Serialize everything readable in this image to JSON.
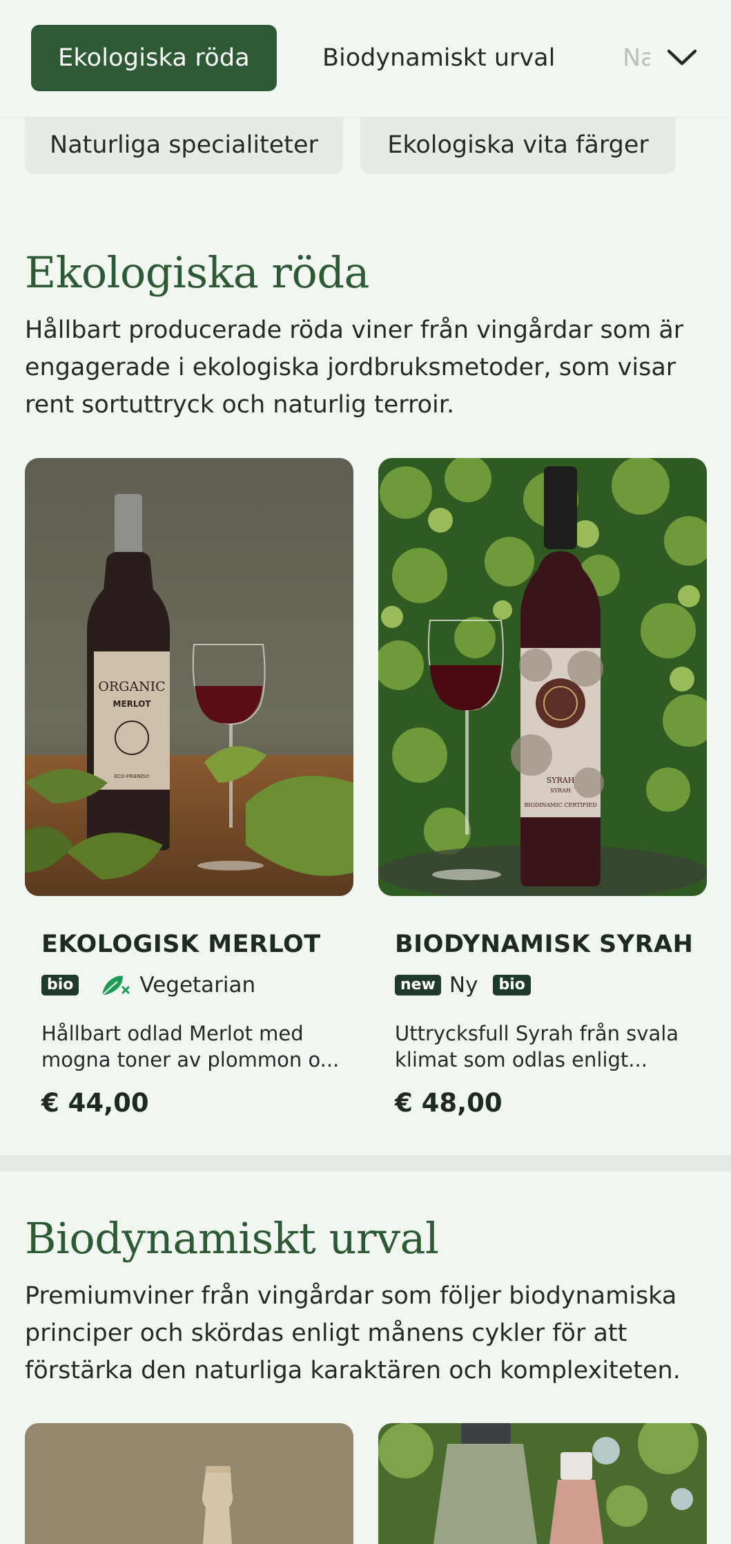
{
  "tabs": {
    "active": "Ekologiska röda",
    "second": "Biodynamiskt urval",
    "third": "Naturliga specialiteter",
    "more_icon": "chevron-down-icon"
  },
  "chips": [
    "Naturliga specialiteter",
    "Ekologiska vita färger"
  ],
  "sections": [
    {
      "title": "Ekologiska röda",
      "description": "Hållbart producerade röda viner från vingårdar som är engagerade i ekologiska jordbruksmetoder, som visar rent sortuttryck och naturlig terroir.",
      "products": [
        {
          "name": "EKOLOGISK MERLOT",
          "badges": [
            {
              "type": "tag",
              "text": "bio"
            },
            {
              "type": "icon-text",
              "icon": "vegetarian-leaf-icon",
              "text": "Vegetarian"
            }
          ],
          "desc_line1": "Hållbart odlad Merlot med",
          "desc_line2": "mogna toner av plommon o...",
          "price": "€ 44,00",
          "label_line1": "ORGANIC",
          "label_line2": "MERLOT",
          "label_line3": "ECO-FRIENDLY"
        },
        {
          "name": "BIODYNAMISK SYRAH",
          "badges": [
            {
              "type": "tag",
              "text": "new"
            },
            {
              "type": "text",
              "text": "Ny"
            },
            {
              "type": "tag",
              "text": "bio"
            }
          ],
          "desc_line1": "Uttrycksfull Syrah från svala",
          "desc_line2": "klimat som odlas enligt...",
          "price": "€ 48,00",
          "label_line1": "SYRAH",
          "label_line2": "SYRAH",
          "label_line3": "BIODINAMIC CERTIFIED"
        }
      ]
    },
    {
      "title": "Biodynamiskt urval",
      "description": "Premiumviner från vingårdar som följer biodynamiska principer och skördas enligt månens cykler för att förstärka den naturliga karaktären och komplexiteten."
    }
  ],
  "colors": {
    "brand_green": "#2d5a34",
    "background": "#f2f6f1",
    "badge_dark": "#1f3a29"
  }
}
